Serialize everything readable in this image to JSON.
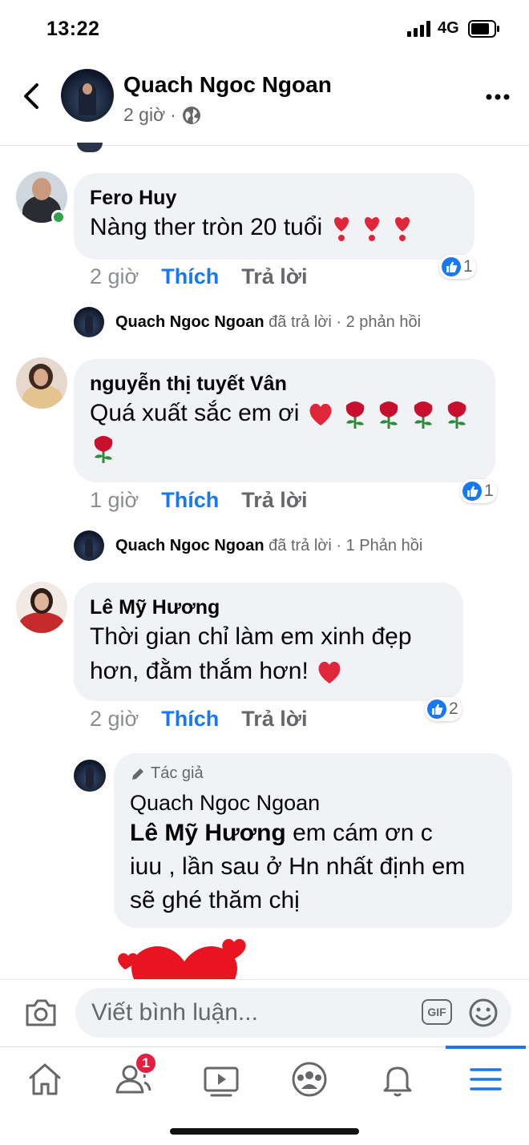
{
  "status_bar": {
    "time": "13:22",
    "network": "4G"
  },
  "post": {
    "author": "Quach Ngoc Ngoan",
    "time": "2 giờ",
    "separator": "·"
  },
  "comments": [
    {
      "author": "Fero Huy",
      "text": "Nàng ther  tròn 20 tuổi",
      "time_ago": "2 giờ",
      "like_label": "Thích",
      "reply_label": "Trả lời",
      "reaction_count": "1",
      "online": true,
      "replied": {
        "name": "Quach Ngoc Ngoan",
        "action": "đã trả lời",
        "count": "2 phản hồi"
      }
    },
    {
      "author": "nguyễn thị tuyết Vân",
      "text": "Quá xuất sắc em ơi",
      "time_ago": "1 giờ",
      "like_label": "Thích",
      "reply_label": "Trả lời",
      "reaction_count": "1",
      "replied": {
        "name": "Quach Ngoc Ngoan",
        "action": "đã trả lời",
        "count": "1 Phản hồi"
      }
    },
    {
      "author": "Lê Mỹ Hương",
      "text_line1": "Thời gian chỉ làm em xinh đẹp",
      "text_line2": "hơn, đằm thắm hơn!",
      "time_ago": "2 giờ",
      "like_label": "Thích",
      "reply_label": "Trả lời",
      "reaction_count": "2"
    }
  ],
  "author_reply": {
    "badge": "Tác giả",
    "author": "Quach Ngoc Ngoan",
    "mention": "Lê Mỹ Hương",
    "text_line1": " em cám ơn c",
    "text_line2": "iuu , lần sau ở Hn nhất định em",
    "text_line3": "sẽ ghé thăm chị"
  },
  "composer": {
    "placeholder": "Viết bình luận...",
    "gif_label": "GIF"
  },
  "bottom_nav": {
    "notification_count": "1",
    "items": [
      "home-icon",
      "friends-icon",
      "watch-icon",
      "groups-icon",
      "notifications-icon",
      "menu-icon"
    ]
  },
  "colors": {
    "accent": "#1877f2",
    "bubble": "#f0f2f5",
    "secondary_text": "#65676b",
    "badge_red": "#e41e3f",
    "online_green": "#31a24c"
  }
}
